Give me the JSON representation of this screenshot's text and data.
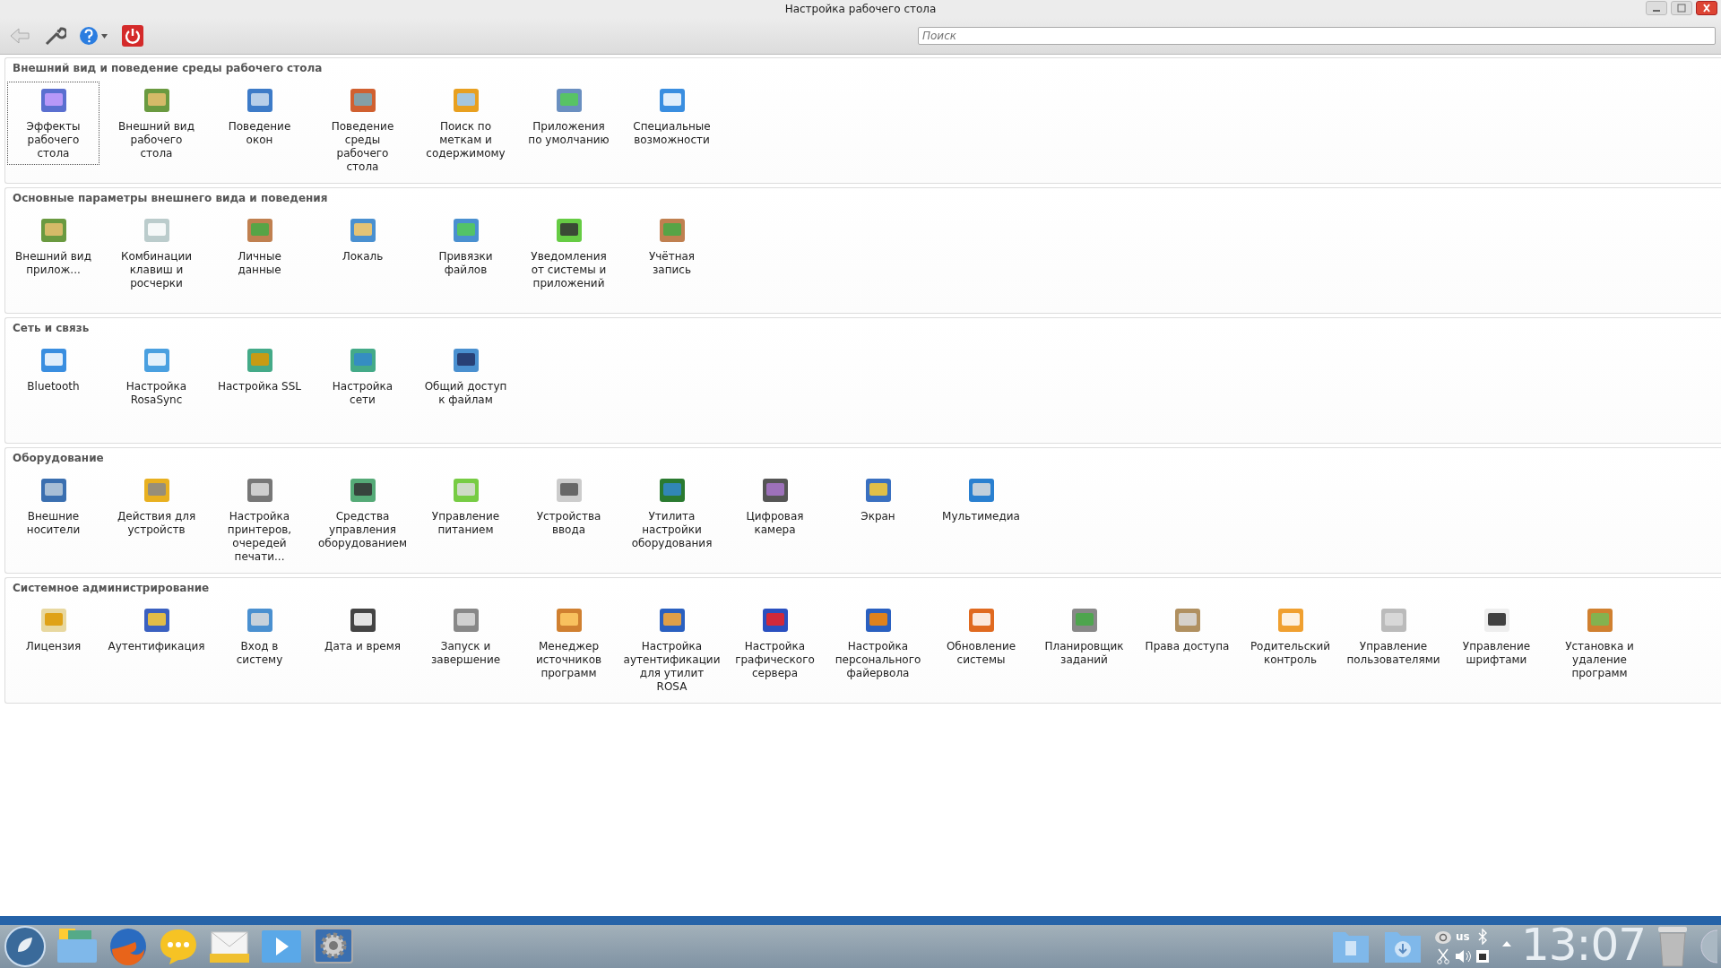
{
  "window": {
    "title": "Настройка рабочего стола"
  },
  "toolbar": {
    "search": {
      "placeholder": "Поиск"
    }
  },
  "sections": [
    {
      "title": "Внешний вид и поведение среды рабочего стола",
      "items": [
        {
          "label": "Эффекты рабочего стола",
          "selected": true
        },
        {
          "label": "Внешний вид рабочего стола",
          "selected": false
        },
        {
          "label": "Поведение окон",
          "selected": false
        },
        {
          "label": "Поведение среды рабочего стола",
          "selected": false
        },
        {
          "label": "Поиск по меткам и содержимому",
          "selected": false
        },
        {
          "label": "Приложения по умолчанию",
          "selected": false
        },
        {
          "label": "Специальные возможности",
          "selected": false
        }
      ]
    },
    {
      "title": "Основные параметры внешнего вида и поведения",
      "items": [
        {
          "label": "Внешний вид прилож...",
          "selected": false
        },
        {
          "label": "Комбинации клавиш и росчерки",
          "selected": false
        },
        {
          "label": "Личные данные",
          "selected": false
        },
        {
          "label": "Локаль",
          "selected": false
        },
        {
          "label": "Привязки файлов",
          "selected": false
        },
        {
          "label": "Уведомления от системы и приложений",
          "selected": false
        },
        {
          "label": "Учётная запись",
          "selected": false
        }
      ]
    },
    {
      "title": "Сеть и связь",
      "items": [
        {
          "label": "Bluetooth",
          "selected": false
        },
        {
          "label": "Настройка RosaSync",
          "selected": false
        },
        {
          "label": "Настройка SSL",
          "selected": false
        },
        {
          "label": "Настройка сети",
          "selected": false
        },
        {
          "label": "Общий доступ к файлам",
          "selected": false
        }
      ]
    },
    {
      "title": "Оборудование",
      "items": [
        {
          "label": "Внешние носители",
          "selected": false
        },
        {
          "label": "Действия для устройств",
          "selected": false
        },
        {
          "label": "Настройка принтеров, очередей печати...",
          "selected": false
        },
        {
          "label": "Средства управления оборудованием",
          "selected": false
        },
        {
          "label": "Управление питанием",
          "selected": false
        },
        {
          "label": "Устройства ввода",
          "selected": false
        },
        {
          "label": "Утилита настройки оборудования",
          "selected": false
        },
        {
          "label": "Цифровая камера",
          "selected": false
        },
        {
          "label": "Экран",
          "selected": false
        },
        {
          "label": "Мультимедиа",
          "selected": false
        }
      ]
    },
    {
      "title": "Системное администрирование",
      "items": [
        {
          "label": "Лицензия",
          "selected": false
        },
        {
          "label": "Аутентификация",
          "selected": false
        },
        {
          "label": "Вход в систему",
          "selected": false
        },
        {
          "label": "Дата и время",
          "selected": false
        },
        {
          "label": "Запуск и завершение",
          "selected": false
        },
        {
          "label": "Менеджер источников программ",
          "selected": false
        },
        {
          "label": "Настройка аутентификации для утилит ROSA",
          "selected": false
        },
        {
          "label": "Настройка графического сервера",
          "selected": false
        },
        {
          "label": "Настройка персонального файервола",
          "selected": false
        },
        {
          "label": "Обновление системы",
          "selected": false
        },
        {
          "label": "Планировщик заданий",
          "selected": false
        },
        {
          "label": "Права доступа",
          "selected": false
        },
        {
          "label": "Родительский контроль",
          "selected": false
        },
        {
          "label": "Управление пользователями",
          "selected": false
        },
        {
          "label": "Управление шрифтами",
          "selected": false
        },
        {
          "label": "Установка и удаление программ",
          "selected": false
        }
      ]
    }
  ],
  "taskbar": {
    "keyboard_layout": "us",
    "clock": "13:07"
  }
}
